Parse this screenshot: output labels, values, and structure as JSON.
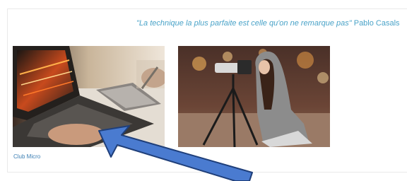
{
  "quote": {
    "text": "\"La technique la plus parfaite est celle qu'on ne remarque pas\"",
    "author": " Pablo Casals"
  },
  "gallery": {
    "items": [
      {
        "caption": "Club Micro",
        "image": "laptop-and-graphics-tablet-photo"
      },
      {
        "caption": "",
        "image": "photographer-with-camera-tripod-photo"
      }
    ]
  },
  "annotation": {
    "arrow_color": "#4a7bd0",
    "arrow_outline": "#1f3f7a"
  }
}
